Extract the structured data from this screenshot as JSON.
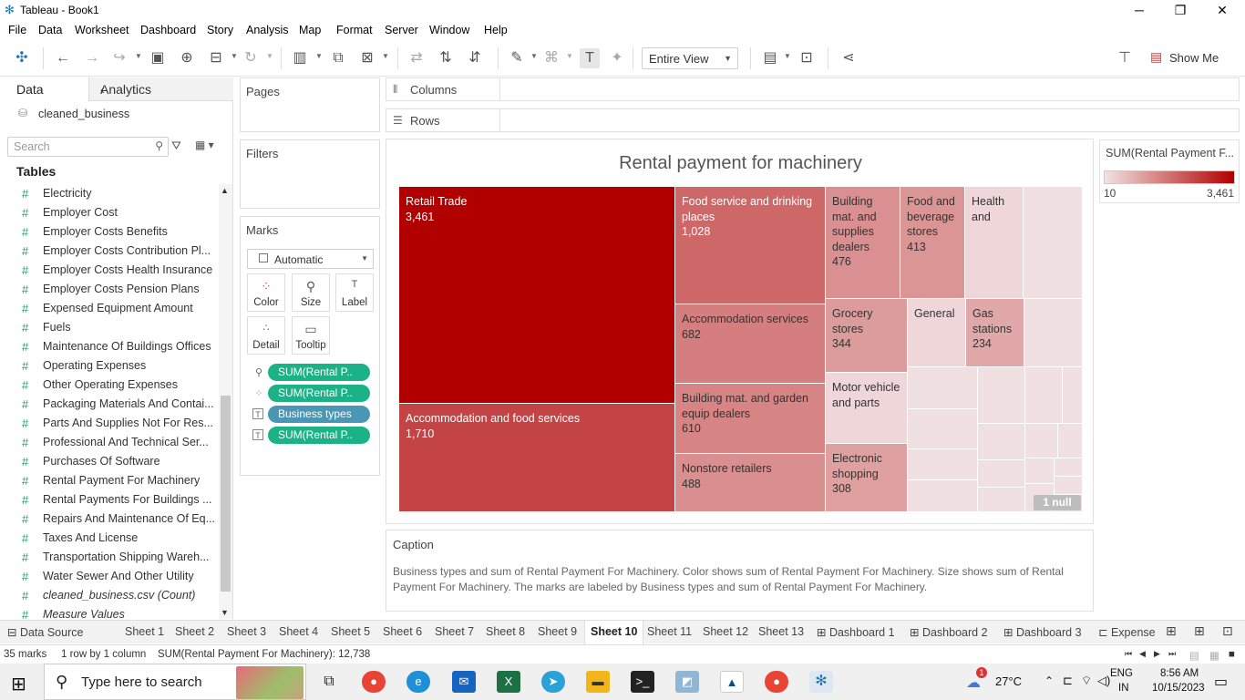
{
  "window": {
    "title": "Tableau - Book1",
    "minimize": "─",
    "maximize": "❐",
    "close": "✕"
  },
  "menu": [
    "File",
    "Data",
    "Worksheet",
    "Dashboard",
    "Story",
    "Analysis",
    "Map",
    "Format",
    "Server",
    "Window",
    "Help"
  ],
  "toolbar": {
    "view_mode": "Entire View",
    "show_me": "Show Me"
  },
  "data_pane": {
    "tab_data": "Data",
    "tab_analytics": "Analytics",
    "datasource": "cleaned_business",
    "search_placeholder": "Search",
    "tables_header": "Tables",
    "fields": [
      "Electricity",
      "Employer Cost",
      "Employer Costs Benefits",
      "Employer Costs Contribution Pl...",
      "Employer Costs Health Insurance",
      "Employer Costs Pension Plans",
      "Expensed Equipment Amount",
      "Fuels",
      "Maintenance Of Buildings Offices",
      "Operating Expenses",
      "Other Operating Expenses",
      "Packaging Materials And Contai...",
      "Parts And Supplies Not For Res...",
      "Professional And Technical Ser...",
      "Purchases Of Software",
      "Rental Payment For Machinery",
      "Rental Payments For Buildings ...",
      "Repairs And Maintenance Of Eq...",
      "Taxes And License",
      "Transportation Shipping Wareh...",
      "Water Sewer And Other Utility"
    ],
    "count_field": "cleaned_business.csv (Count)",
    "measure_values": "Measure Values"
  },
  "shelves": {
    "pages": "Pages",
    "filters": "Filters",
    "marks": "Marks",
    "mark_type": "Automatic",
    "mark_buttons": [
      "Color",
      "Size",
      "Label",
      "Detail",
      "Tooltip"
    ],
    "pills": [
      "SUM(Rental P..",
      "SUM(Rental P..",
      "Business types",
      "SUM(Rental P.."
    ],
    "columns": "Columns",
    "rows": "Rows"
  },
  "viz": {
    "title": "Rental payment for machinery",
    "null_badge": "1 null"
  },
  "chart_data": {
    "type": "treemap",
    "title": "Rental payment for machinery",
    "color_measure": "SUM(Rental Payment F...",
    "color_range": [
      10,
      3461
    ],
    "color_low": "#f2e2e3",
    "color_high": "#b00000",
    "items": [
      {
        "label": "Retail Trade",
        "value": 3461
      },
      {
        "label": "Accommodation and food services",
        "value": 1710
      },
      {
        "label": "Food service and drinking places",
        "value": 1028
      },
      {
        "label": "Accommodation services",
        "value": 682
      },
      {
        "label": "Building mat. and garden equip dealers",
        "value": 610
      },
      {
        "label": "Nonstore retailers",
        "value": 488
      },
      {
        "label": "Building mat. and supplies dealers",
        "value": 476
      },
      {
        "label": "Food and beverage stores",
        "value": 413
      },
      {
        "label": "Health and",
        "value": null
      },
      {
        "label": "Grocery stores",
        "value": 344
      },
      {
        "label": "General",
        "value": null
      },
      {
        "label": "Gas stations",
        "value": 234
      },
      {
        "label": "Motor vehicle and parts",
        "value": null
      },
      {
        "label": "Electronic shopping",
        "value": 308
      }
    ]
  },
  "legend": {
    "title": "SUM(Rental Payment F...",
    "min": "10",
    "max": "3,461"
  },
  "caption": {
    "header": "Caption",
    "text": "Business types and sum of Rental Payment For Machinery.  Color shows sum of Rental Payment For Machinery.  Size shows sum of Rental Payment For Machinery.  The marks are labeled by Business types and sum of Rental Payment For Machinery."
  },
  "sheet_tabs": [
    "Data Source",
    "Sheet 1",
    "Sheet 2",
    "Sheet 3",
    "Sheet 4",
    "Sheet 5",
    "Sheet 6",
    "Sheet 7",
    "Sheet 8",
    "Sheet 9",
    "Sheet 10",
    "Sheet 11",
    "Sheet 12",
    "Sheet 13",
    "Dashboard 1",
    "Dashboard 2",
    "Dashboard 3",
    "Expense"
  ],
  "active_sheet": "Sheet 10",
  "status": {
    "marks": "35 marks",
    "dims": "1 row by 1 column",
    "sum": "SUM(Rental Payment For Machinery): 12,738"
  },
  "taskbar": {
    "search_placeholder": "Type here to search",
    "weather": "27°C",
    "lang_top": "ENG",
    "lang_bottom": "IN",
    "time": "8:56 AM",
    "date": "10/15/2023",
    "notif_count": "1"
  }
}
